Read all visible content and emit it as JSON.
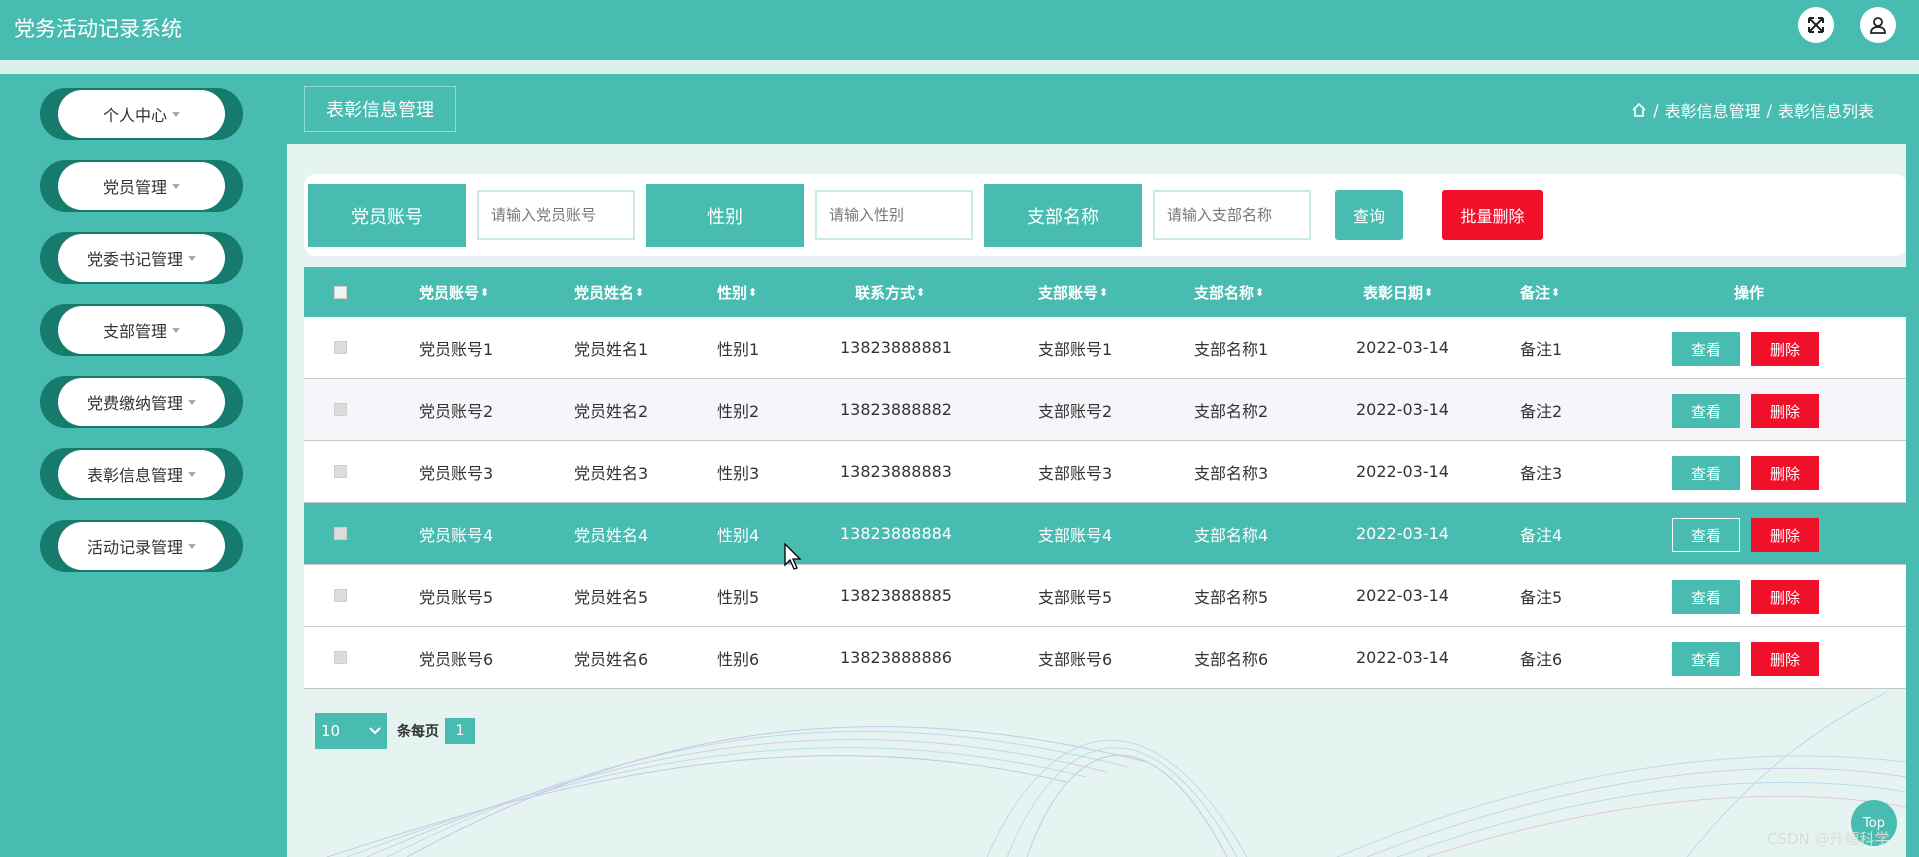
{
  "app": {
    "title": "党务活动记录系统"
  },
  "sidebar": {
    "items": [
      {
        "label": "个人中心"
      },
      {
        "label": "党员管理"
      },
      {
        "label": "党委书记管理"
      },
      {
        "label": "支部管理"
      },
      {
        "label": "党费缴纳管理"
      },
      {
        "label": "表彰信息管理"
      },
      {
        "label": "活动记录管理"
      }
    ]
  },
  "header": {
    "page_title": "表彰信息管理",
    "breadcrumb": {
      "home_icon": "home-icon",
      "sep": "/",
      "level1": "表彰信息管理",
      "level2": "表彰信息列表"
    }
  },
  "search": {
    "account_label": "党员账号",
    "account_placeholder": "请输入党员账号",
    "gender_label": "性别",
    "gender_placeholder": "请输入性别",
    "branch_label": "支部名称",
    "branch_placeholder": "请输入支部名称",
    "query_label": "查询",
    "batch_delete_label": "批量删除"
  },
  "table": {
    "columns": [
      {
        "label": "党员账号"
      },
      {
        "label": "党员姓名"
      },
      {
        "label": "性别"
      },
      {
        "label": "联系方式"
      },
      {
        "label": "支部账号"
      },
      {
        "label": "支部名称"
      },
      {
        "label": "表彰日期"
      },
      {
        "label": "备注"
      },
      {
        "label": "操作"
      }
    ],
    "sort_icon": "⬍",
    "view_label": "查看",
    "delete_label": "删除",
    "rows": [
      {
        "account": "党员账号1",
        "name": "党员姓名1",
        "gender": "性别1",
        "phone": "13823888881",
        "branch_no": "支部账号1",
        "branch_name": "支部名称1",
        "date": "2022-03-14",
        "note": "备注1"
      },
      {
        "account": "党员账号2",
        "name": "党员姓名2",
        "gender": "性别2",
        "phone": "13823888882",
        "branch_no": "支部账号2",
        "branch_name": "支部名称2",
        "date": "2022-03-14",
        "note": "备注2"
      },
      {
        "account": "党员账号3",
        "name": "党员姓名3",
        "gender": "性别3",
        "phone": "13823888883",
        "branch_no": "支部账号3",
        "branch_name": "支部名称3",
        "date": "2022-03-14",
        "note": "备注3"
      },
      {
        "account": "党员账号4",
        "name": "党员姓名4",
        "gender": "性别4",
        "phone": "13823888884",
        "branch_no": "支部账号4",
        "branch_name": "支部名称4",
        "date": "2022-03-14",
        "note": "备注4"
      },
      {
        "account": "党员账号5",
        "name": "党员姓名5",
        "gender": "性别5",
        "phone": "13823888885",
        "branch_no": "支部账号5",
        "branch_name": "支部名称5",
        "date": "2022-03-14",
        "note": "备注5"
      },
      {
        "account": "党员账号6",
        "name": "党员姓名6",
        "gender": "性别6",
        "phone": "13823888886",
        "branch_no": "支部账号6",
        "branch_name": "支部名称6",
        "date": "2022-03-14",
        "note": "备注6"
      }
    ],
    "highlighted_row": 4
  },
  "pagination": {
    "page_size": "10",
    "per_page_label": "条每页",
    "current_page": "1"
  },
  "top_button": "Top",
  "watermark": "CSDN @升幅科学",
  "colors": {
    "primary": "#48bcb0",
    "danger": "#f0102a",
    "sidebar_dark": "#167a6c"
  }
}
